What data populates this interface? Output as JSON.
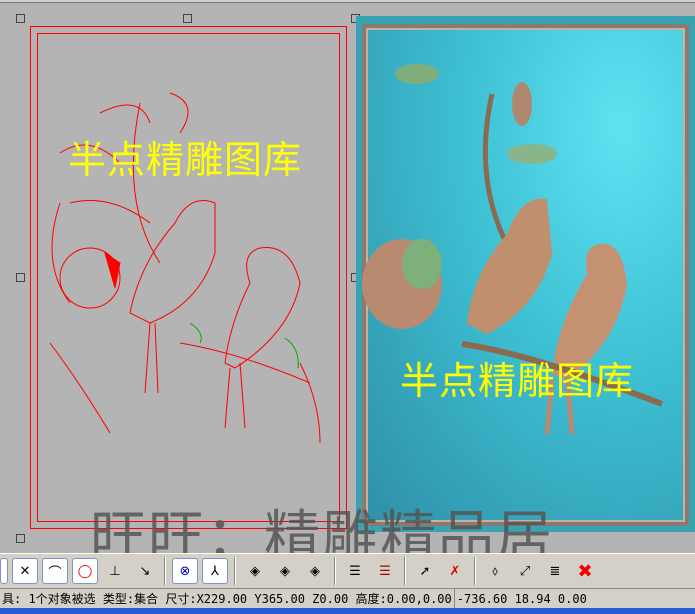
{
  "watermarks": {
    "top": "半点精雕图库",
    "relief": "半点精雕图库",
    "bottom": "旺旺：精雕精品居"
  },
  "toolbar": {
    "icons": [
      "curve-cross-icon",
      "fillet-icon",
      "circle-points-icon",
      "perpendicular-icon",
      "tangent-icon",
      "point-icon",
      "axis-icon",
      "diamond-1-icon",
      "diamond-2-icon",
      "diamond-3-icon",
      "layer-1-icon",
      "layer-2-icon",
      "select-point-icon",
      "deselect-icon",
      "project-icon",
      "measure-icon",
      "list-icon",
      "delete-icon"
    ]
  },
  "status": {
    "left": "具: 1个对象被选 类型:集合 尺寸:X229.00 Y365.00 Z0.00 高度:0.00,0.00",
    "coords": "-736.60 18.94 0.00"
  },
  "colors": {
    "vector": "#ff0000",
    "watermark": "#ffff00",
    "relief": "#3dbfd2"
  }
}
